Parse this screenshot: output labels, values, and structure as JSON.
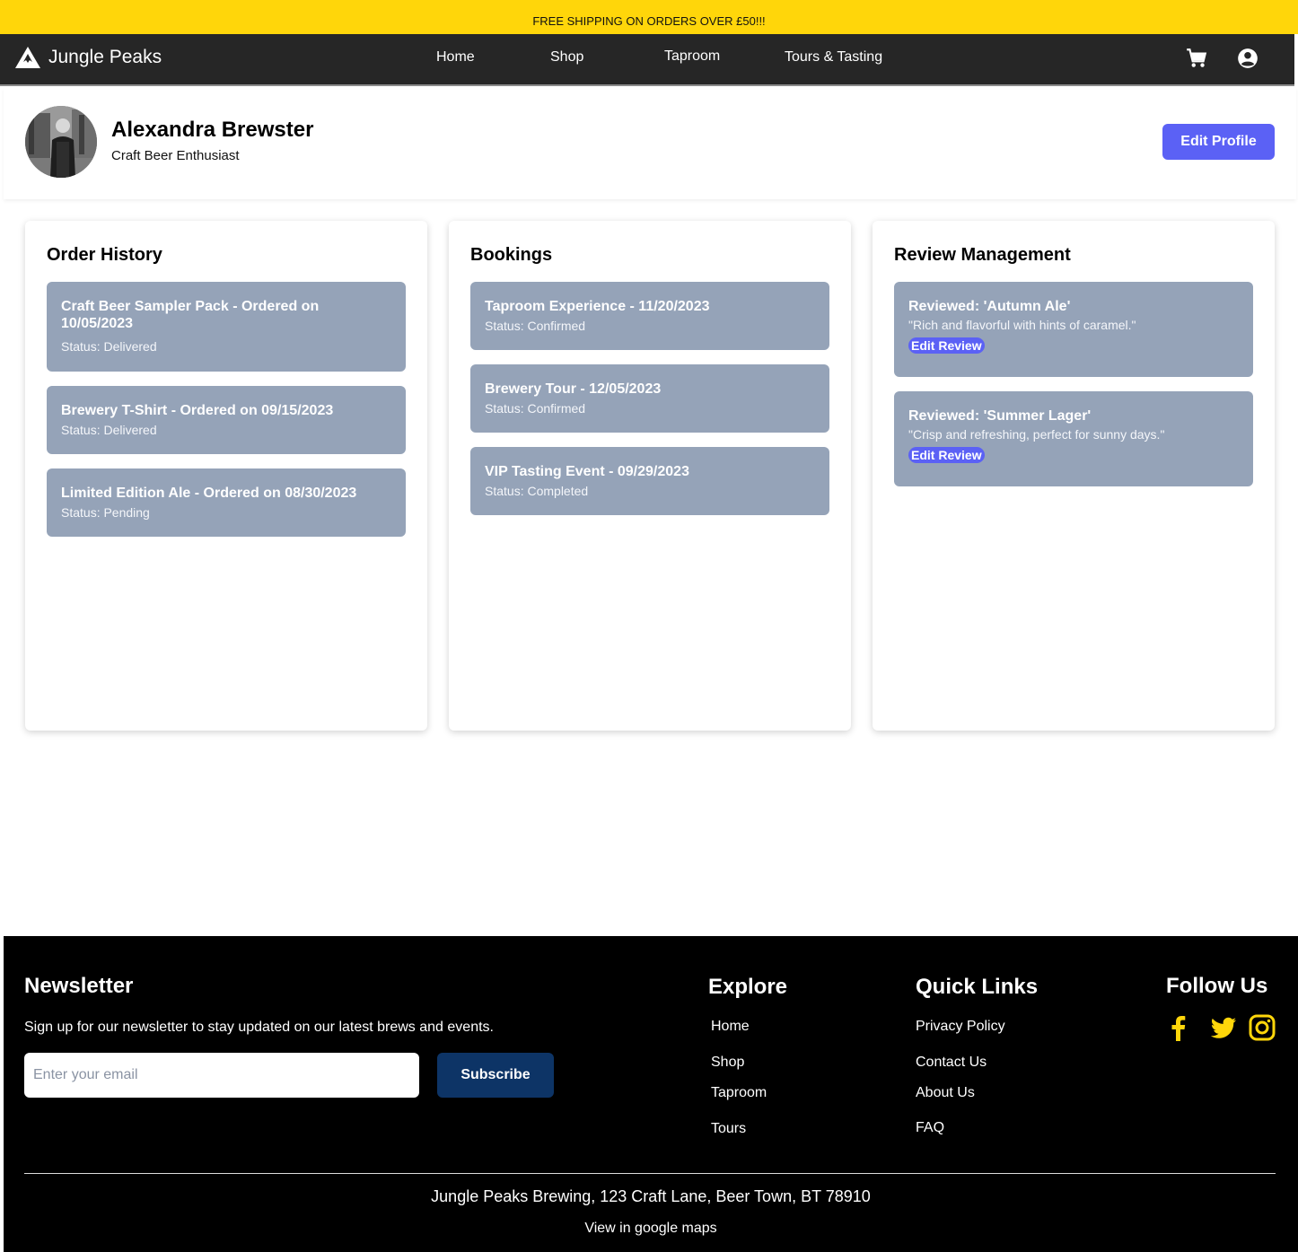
{
  "promo": {
    "text": "FREE SHIPPING ON ORDERS OVER £50!!!"
  },
  "nav": {
    "brand": "Jungle Peaks",
    "links": [
      "Home",
      "Shop",
      "Taproom",
      "Tours & Tasting"
    ],
    "icons": [
      "cart-icon",
      "account-icon"
    ]
  },
  "profile": {
    "name": "Alexandra Brewster",
    "tagline": "Craft Beer Enthusiast",
    "edit_label": "Edit Profile"
  },
  "orders": {
    "title": "Order History",
    "items": [
      {
        "title": "Craft Beer Sampler Pack - Ordered on 10/05/2023",
        "status": "Status: Delivered"
      },
      {
        "title": "Brewery T-Shirt - Ordered on 09/15/2023",
        "status": "Status: Delivered"
      },
      {
        "title": "Limited Edition Ale - Ordered on 08/30/2023",
        "status": "Status: Pending"
      }
    ]
  },
  "bookings": {
    "title": "Bookings",
    "items": [
      {
        "title": "Taproom Experience - 11/20/2023",
        "status": "Status: Confirmed"
      },
      {
        "title": "Brewery Tour - 12/05/2023",
        "status": "Status: Confirmed"
      },
      {
        "title": "VIP Tasting Event - 09/29/2023",
        "status": "Status: Completed"
      }
    ]
  },
  "reviews": {
    "title": "Review Management",
    "items": [
      {
        "title": "Reviewed: 'Autumn Ale'",
        "quote": "\"Rich and flavorful with hints of caramel.\"",
        "button": "Edit Review"
      },
      {
        "title": "Reviewed: 'Summer Lager'",
        "quote": "\"Crisp and refreshing, perfect for sunny days.\"",
        "button": "Edit Review"
      }
    ]
  },
  "footer": {
    "newsletter_title": "Newsletter",
    "newsletter_desc": "Sign up for our newsletter to stay updated on our latest brews and events.",
    "email_placeholder": "Enter your email",
    "subscribe_label": "Subscribe",
    "explore_title": "Explore",
    "explore_links": [
      "Home",
      "Shop",
      "Taproom",
      "Tours"
    ],
    "quick_title": "Quick Links",
    "quick_links": [
      "Privacy Policy",
      "Contact Us",
      "About Us",
      "FAQ"
    ],
    "follow_title": "Follow Us",
    "social_icons": [
      "facebook-icon",
      "twitter-icon",
      "instagram-icon"
    ],
    "social_color": "#ffd60a",
    "address": "Jungle Peaks Brewing, 123 Craft Lane, Beer Town, BT 78910",
    "maps_link": "View in google maps"
  },
  "colors": {
    "promo_bg": "#ffd60a",
    "nav_bg": "#262626",
    "accent": "#5b61f5",
    "item_bg": "#95a3b8",
    "subscribe_bg": "#0d3466",
    "footer_bg": "#000000"
  }
}
